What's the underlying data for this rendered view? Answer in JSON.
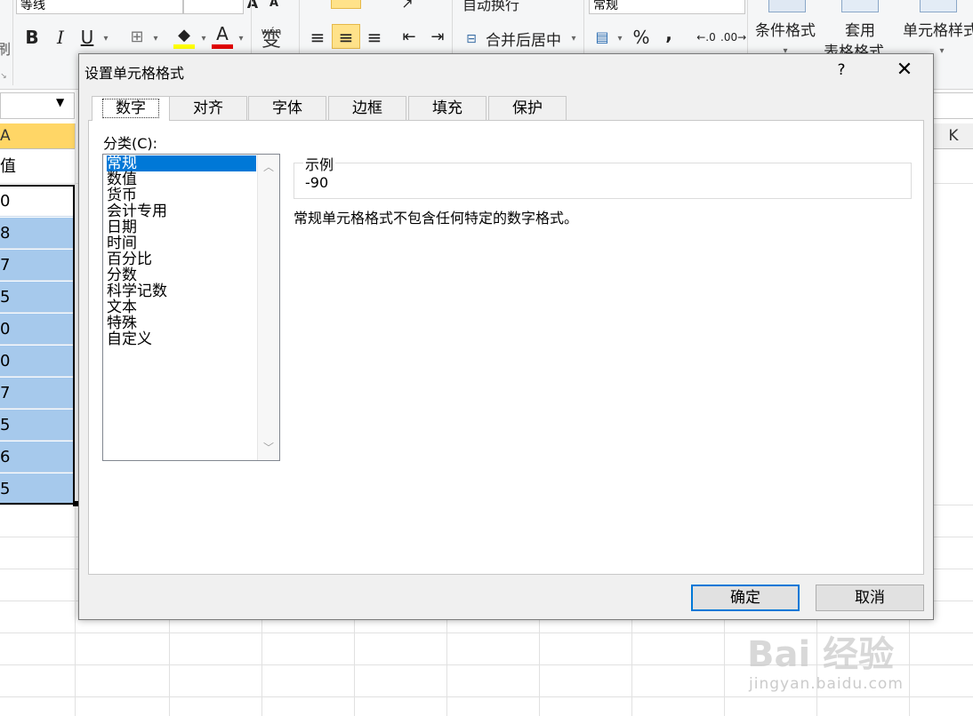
{
  "ribbon": {
    "font_name": "等线",
    "bold": "B",
    "italic": "I",
    "underline": "U",
    "font_color_glyph": "A",
    "phonetic_glyph": "wén",
    "merge_center": "合并后居中",
    "wrap_text": "自动换行",
    "number_format": "常规",
    "percent": "%",
    "comma": ",",
    "conditional_format": "条件格式",
    "table_format_1": "套用",
    "table_format_2": "表格格式",
    "cell_style": "单元格样式",
    "clipboard_partial": "刷"
  },
  "sheet": {
    "column_a_partial": "A",
    "column_k": "K",
    "header_cell_partial": "值",
    "values_partial": [
      "0",
      "8",
      "7",
      "5",
      "0",
      "0",
      "7",
      "5",
      "6",
      "5"
    ]
  },
  "dialog": {
    "title": "设置单元格格式",
    "help": "?",
    "close": "✕",
    "tabs": [
      "数字",
      "对齐",
      "字体",
      "边框",
      "填充",
      "保护"
    ],
    "active_tab": "数字",
    "category_label": "分类(C):",
    "categories": [
      "常规",
      "数值",
      "货币",
      "会计专用",
      "日期",
      "时间",
      "百分比",
      "分数",
      "科学记数",
      "文本",
      "特殊",
      "自定义"
    ],
    "selected_category": "常规",
    "sample_label": "示例",
    "sample_value": "-90",
    "description": "常规单元格格式不包含任何特定的数字格式。",
    "ok": "确定",
    "cancel": "取消"
  },
  "watermark": {
    "text": "Bai 经验",
    "url": "jingyan.baidu.com"
  },
  "colors": {
    "selection_blue": "#0078d7",
    "cell_selection": "#a6c9ec",
    "header_highlight": "#ffd666"
  }
}
